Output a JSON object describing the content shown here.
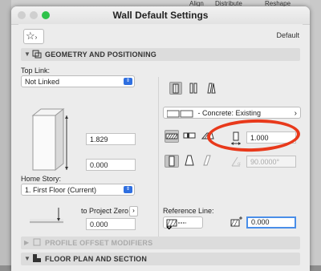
{
  "background_app": {
    "toolbar_items": [
      "Align",
      "Distribute",
      "Reshape"
    ]
  },
  "window": {
    "title": "Wall Default Settings"
  },
  "header": {
    "favorites_icon": "star-icon",
    "default_label": "Default"
  },
  "sections": {
    "geometry": "GEOMETRY AND POSITIONING",
    "profile": "PROFILE OFFSET MODIFIERS",
    "floorplan": "FLOOR PLAN AND SECTION"
  },
  "geometry": {
    "top_link_label": "Top Link:",
    "top_link_value": "Not Linked",
    "height_value": "1.829",
    "offset_value": "0.000",
    "home_story_label": "Home Story:",
    "home_story_value": "1. First Floor (Current)",
    "to_project_zero_label": "to Project Zero",
    "project_zero_value": "0.000",
    "building_material": "- Concrete: Existing",
    "thickness_value": "1.000",
    "slant_angle_value": "90.0000°",
    "reference_line_label": "Reference Line:",
    "reference_offset_value": "0.000"
  },
  "colors": {
    "accent": "#2f6fe0",
    "annotation": "#e8391b",
    "focus_ring": "#4a8ee8"
  }
}
